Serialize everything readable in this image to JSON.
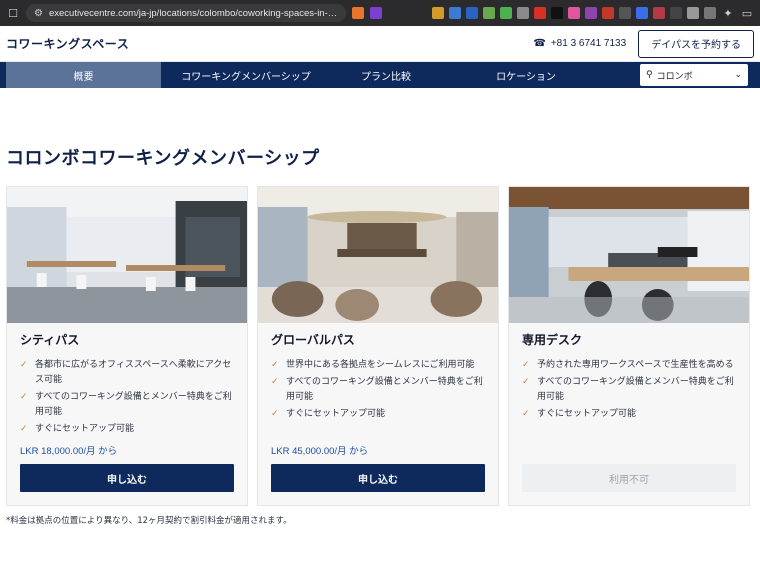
{
  "browser": {
    "url": "executivecentre.com/ja-jp/locations/colombo/coworking-spaces-in-colombo/"
  },
  "header": {
    "brand": "コワーキングスペース",
    "phone": "+81 3 6741 7133",
    "book_label": "デイパスを予約する"
  },
  "nav": {
    "items": [
      {
        "label": "概要",
        "active": true
      },
      {
        "label": "コワーキングメンバーシップ",
        "active": false
      },
      {
        "label": "プラン比較",
        "active": false
      },
      {
        "label": "ロケーション",
        "active": false
      }
    ],
    "location": "コロンボ"
  },
  "main": {
    "title": "コロンボコワーキングメンバーシップ",
    "cards": [
      {
        "title": "シティパス",
        "features": [
          "各都市に広がるオフィススペースへ柔軟にアクセス可能",
          "すべてのコワーキング設備とメンバー特典をご利用可能",
          "すぐにセットアップ可能"
        ],
        "price": "LKR 18,000.00/月 から",
        "button": "申し込む",
        "available": true
      },
      {
        "title": "グローバルパス",
        "features": [
          "世界中にある各拠点をシームレスにご利用可能",
          "すべてのコワーキング設備とメンバー特典をご利用可能",
          "すぐにセットアップ可能"
        ],
        "price": "LKR 45,000.00/月 から",
        "button": "申し込む",
        "available": true
      },
      {
        "title": "専用デスク",
        "features": [
          "予約された専用ワークスペースで生産性を高める",
          "すべてのコワーキング設備とメンバー特典をご利用可能",
          "すぐにセットアップ可能"
        ],
        "price": "",
        "button": "利用不可",
        "available": false
      }
    ],
    "footnote": "*料金は拠点の位置により異なり、12ヶ月契約で割引料金が適用されます。"
  },
  "colors": {
    "navy": "#0e2a5c",
    "nav_active": "#5b7398",
    "accent_check": "#c9844b",
    "price_blue": "#1d4fa0"
  }
}
